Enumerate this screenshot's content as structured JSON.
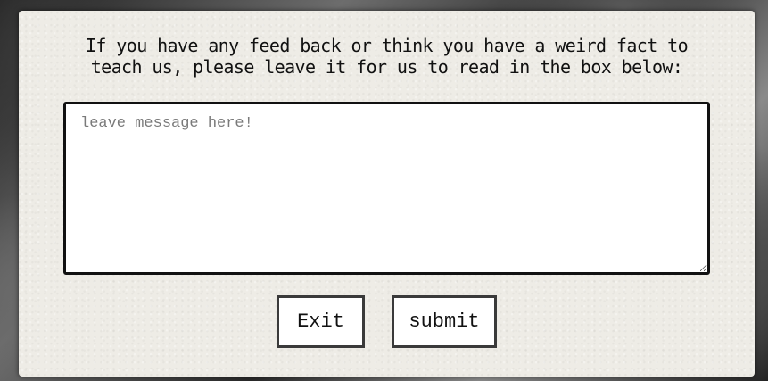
{
  "feedback_modal": {
    "prompt_line_1": "If you have any feed back or think you have a weird fact to",
    "prompt_line_2": "teach us, please leave it for us to read in the box below:",
    "message_placeholder": "leave message here!",
    "message_value": "",
    "exit_label": "Exit",
    "submit_label": "submit"
  }
}
